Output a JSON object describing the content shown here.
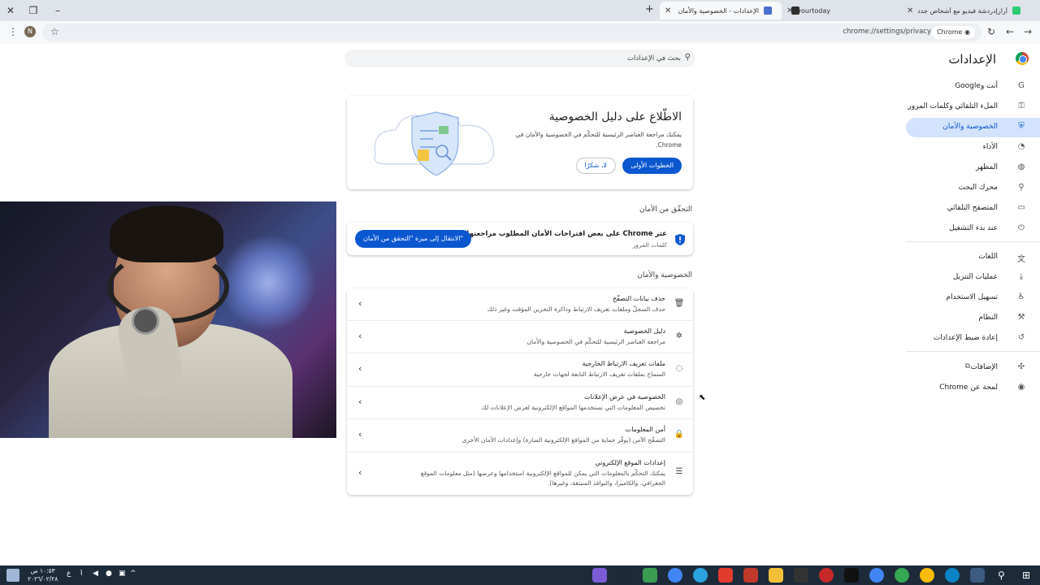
{
  "browser": {
    "tabs": [
      {
        "label": "أرارإدردشة فيديو مع أشخاص جدد",
        "active": false
      },
      {
        "label": "yourtoday",
        "active": false
      },
      {
        "label": "الإعدادات - الخصوصية والأمان",
        "active": true
      }
    ],
    "url": "chrome://settings/privacy",
    "chip_label": "Chrome",
    "avatar_initial": "N"
  },
  "settings": {
    "title": "الإعدادات",
    "search_placeholder": "بحث في الإعدادات",
    "nav": [
      {
        "label": "أنت وGoogle",
        "icon": "google-icon"
      },
      {
        "label": "الملء التلقائي وكلمات المرور",
        "icon": "key-icon"
      },
      {
        "label": "الخصوصية والأمان",
        "icon": "shield-icon",
        "active": true
      },
      {
        "label": "الأداء",
        "icon": "speedometer-icon"
      },
      {
        "label": "المظهر",
        "icon": "palette-icon"
      },
      {
        "label": "محرك البحث",
        "icon": "search-icon"
      },
      {
        "label": "المتصفح التلقائي",
        "icon": "browser-icon"
      },
      {
        "label": "عند بدء التشغيل",
        "icon": "power-icon"
      },
      {
        "label": "اللغات",
        "icon": "translate-icon"
      },
      {
        "label": "عمليات التنزيل",
        "icon": "download-icon"
      },
      {
        "label": "تسهيل الاستخدام",
        "icon": "accessibility-icon"
      },
      {
        "label": "النظام",
        "icon": "wrench-icon"
      },
      {
        "label": "إعادة ضبط الإعدادات",
        "icon": "reset-icon"
      },
      {
        "label": "الإضافات",
        "icon": "puzzle-icon"
      },
      {
        "label": "لمحة عن Chrome",
        "icon": "chrome-icon"
      }
    ],
    "promo": {
      "title": "الاطّلاع على دليل الخصوصية",
      "description": "يمكنك مراجعة العناصر الرئيسية للتحكّم في الخصوصية والأمان في Chrome.",
      "primary_button": "الخطوات الأولى",
      "secondary_button": "لا، شكرًا"
    },
    "safety_check": {
      "heading": "التحقّق من الأمان",
      "message": "عثر Chrome على بعض اقتراحات الأمان المطلوب مراجعتها",
      "sub": "كلمات المرور",
      "button": "الانتقال إلى ميزة \"التحقق من الأمان\""
    },
    "privacy_section": {
      "heading": "الخصوصية والأمان",
      "rows": [
        {
          "title": "حذف بيانات التصفّح",
          "sub": "حذف السجلّ وملفات تعريف الارتباط وذاكرة التخزين المؤقت وغير ذلك",
          "icon": "trash-icon"
        },
        {
          "title": "دليل الخصوصية",
          "sub": "مراجعة العناصر الرئيسية للتحكّم في الخصوصية والأمان",
          "icon": "privacy-guide-icon"
        },
        {
          "title": "ملفات تعريف الارتباط الخارجية",
          "sub": "السماح بملفات تعريف الارتباط التابعة لجهات خارجية",
          "icon": "cookie-icon"
        },
        {
          "title": "الخصوصية في عرض الإعلانات",
          "sub": "تخصيص المعلومات التي تستخدمها المواقع الإلكترونية لعرض الإعلانات لك",
          "icon": "ads-icon"
        },
        {
          "title": "أمن المعلومات",
          "sub": "التصفّح الآمن (يوفّر حماية من المواقع الإلكترونية الضارة) وإعدادات الأمان الأخرى",
          "icon": "lock-icon"
        },
        {
          "title": "إعدادات الموقع الإلكتروني",
          "sub": "يمكنك التحكّم بالمعلومات التي يمكن للمواقع الإلكترونية استخدامها وعرضها (مثل معلومات الموقع الجغرافي، والكاميرا، والنوافذ المنبثقة، وغيرها).",
          "icon": "sliders-icon"
        }
      ]
    }
  },
  "taskbar": {
    "time": "١٠:٥٣ ص",
    "date": "٢٠٢٦/٠٢/٢٨",
    "lang": "ع"
  },
  "colors": {
    "accent": "#0b57d0",
    "active_nav_bg": "#d3e3fd",
    "taskbar": "#1c2a3a"
  }
}
